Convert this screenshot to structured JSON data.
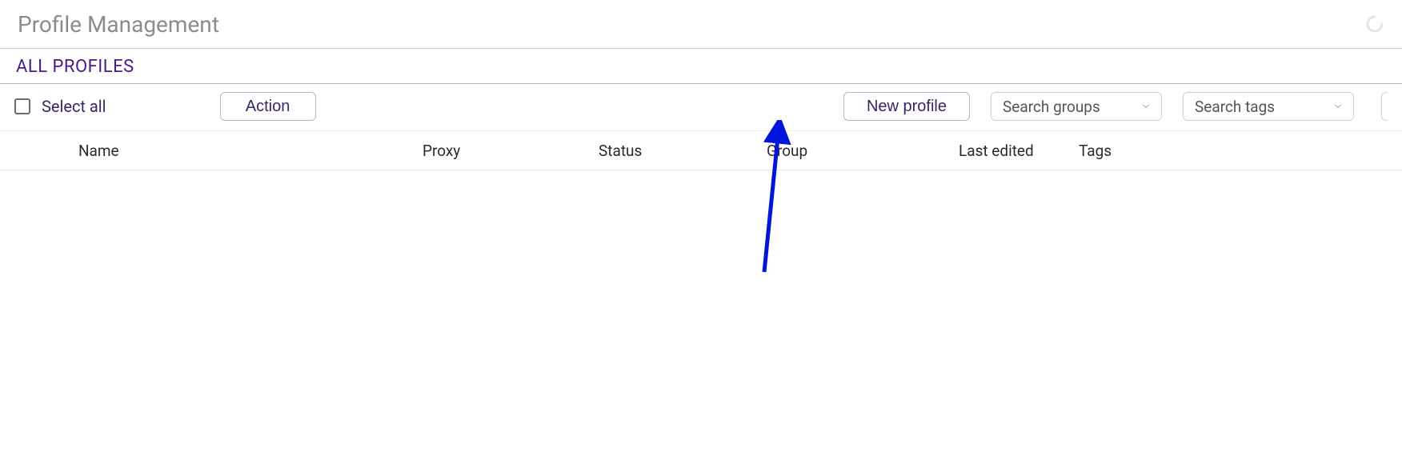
{
  "header": {
    "title": "Profile Management"
  },
  "section": {
    "title": "ALL PROFILES"
  },
  "toolbar": {
    "select_all": "Select all",
    "action_btn": "Action",
    "new_profile_btn": "New profile",
    "search_groups_placeholder": "Search groups",
    "search_tags_placeholder": "Search tags"
  },
  "columns": {
    "name": "Name",
    "proxy": "Proxy",
    "status": "Status",
    "group": "Group",
    "last_edited": "Last edited",
    "tags": "Tags"
  },
  "rows": []
}
